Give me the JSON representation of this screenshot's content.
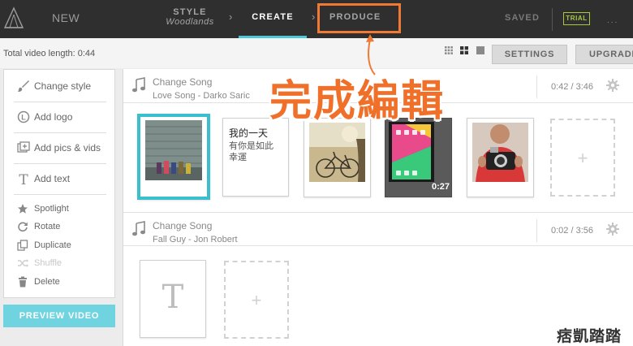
{
  "nav": {
    "new_label": "NEW",
    "style_label": "STYLE",
    "style_value": "Woodlands",
    "chevron": "›",
    "create_label": "CREATE",
    "produce_label": "PRODUCE",
    "saved_label": "SAVED",
    "trial_label": "TRIAL",
    "more_label": "...",
    "active_tab": "CREATE"
  },
  "toolbar": {
    "video_length": "Total video length: 0:44",
    "settings_label": "SETTINGS",
    "upgrade_label": "UPGRADE",
    "view_icons": [
      "grid-small-icon",
      "grid-large-icon",
      "single-view-icon"
    ]
  },
  "sidebar": {
    "tools": [
      {
        "label": "Change style",
        "icon": "brush-icon"
      },
      {
        "label": "Add logo",
        "icon": "logo-icon"
      },
      {
        "label": "Add pics & vids",
        "icon": "add-media-icon"
      },
      {
        "label": "Add text",
        "icon": "text-icon"
      }
    ],
    "options": [
      {
        "label": "Spotlight",
        "icon": "star-icon",
        "enabled": true
      },
      {
        "label": "Rotate",
        "icon": "rotate-icon",
        "enabled": true
      },
      {
        "label": "Duplicate",
        "icon": "duplicate-icon",
        "enabled": true
      },
      {
        "label": "Shuffle",
        "icon": "shuffle-icon",
        "enabled": false
      },
      {
        "label": "Delete",
        "icon": "trash-icon",
        "enabled": true
      }
    ],
    "preview_label": "PREVIEW VIDEO"
  },
  "songs": [
    {
      "change_label": "Change Song",
      "title": "Love Song - Darko Saric",
      "duration": "0:42 / 3:46",
      "slides": [
        {
          "type": "photo",
          "subject": "boots-on-wooden-steps",
          "selected": true
        },
        {
          "type": "text",
          "lines": [
            "我的一天",
            "有你是如此",
            "幸運"
          ]
        },
        {
          "type": "photo",
          "subject": "bicycle-in-field"
        },
        {
          "type": "video",
          "subject": "phone-home-screen",
          "duration": "0:27"
        },
        {
          "type": "photo",
          "subject": "person-with-camera"
        }
      ],
      "add_label": "+"
    },
    {
      "change_label": "Change Song",
      "title": "Fall Guy - Jon Robert",
      "duration": "0:02 / 3:56",
      "slides": [
        {
          "type": "text-placeholder",
          "glyph": "T"
        }
      ],
      "add_label": "+"
    }
  ],
  "annotation": {
    "text": "完成編輯",
    "color": "#f0702a"
  },
  "watermark": "痞凱踏踏",
  "colors": {
    "accent": "#3bbfcc",
    "topbar": "#2f2f2f",
    "trial": "#a8c93f",
    "highlight": "#f07a34"
  }
}
